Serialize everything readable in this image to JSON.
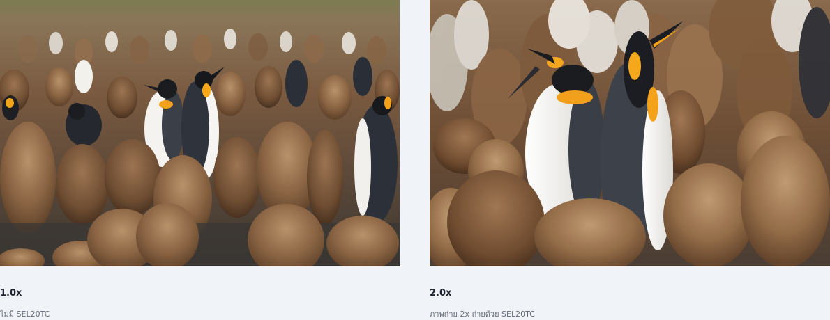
{
  "comparison": [
    {
      "zoom_label": "1.0x",
      "description": "ไม่มี SEL20TC",
      "photo_subject": "king penguins with brown chicks"
    },
    {
      "zoom_label": "2.0x",
      "description": "ภาพถ่าย 2x ถ่ายด้วย SEL20TC",
      "photo_subject": "king penguins with brown chicks"
    }
  ]
}
